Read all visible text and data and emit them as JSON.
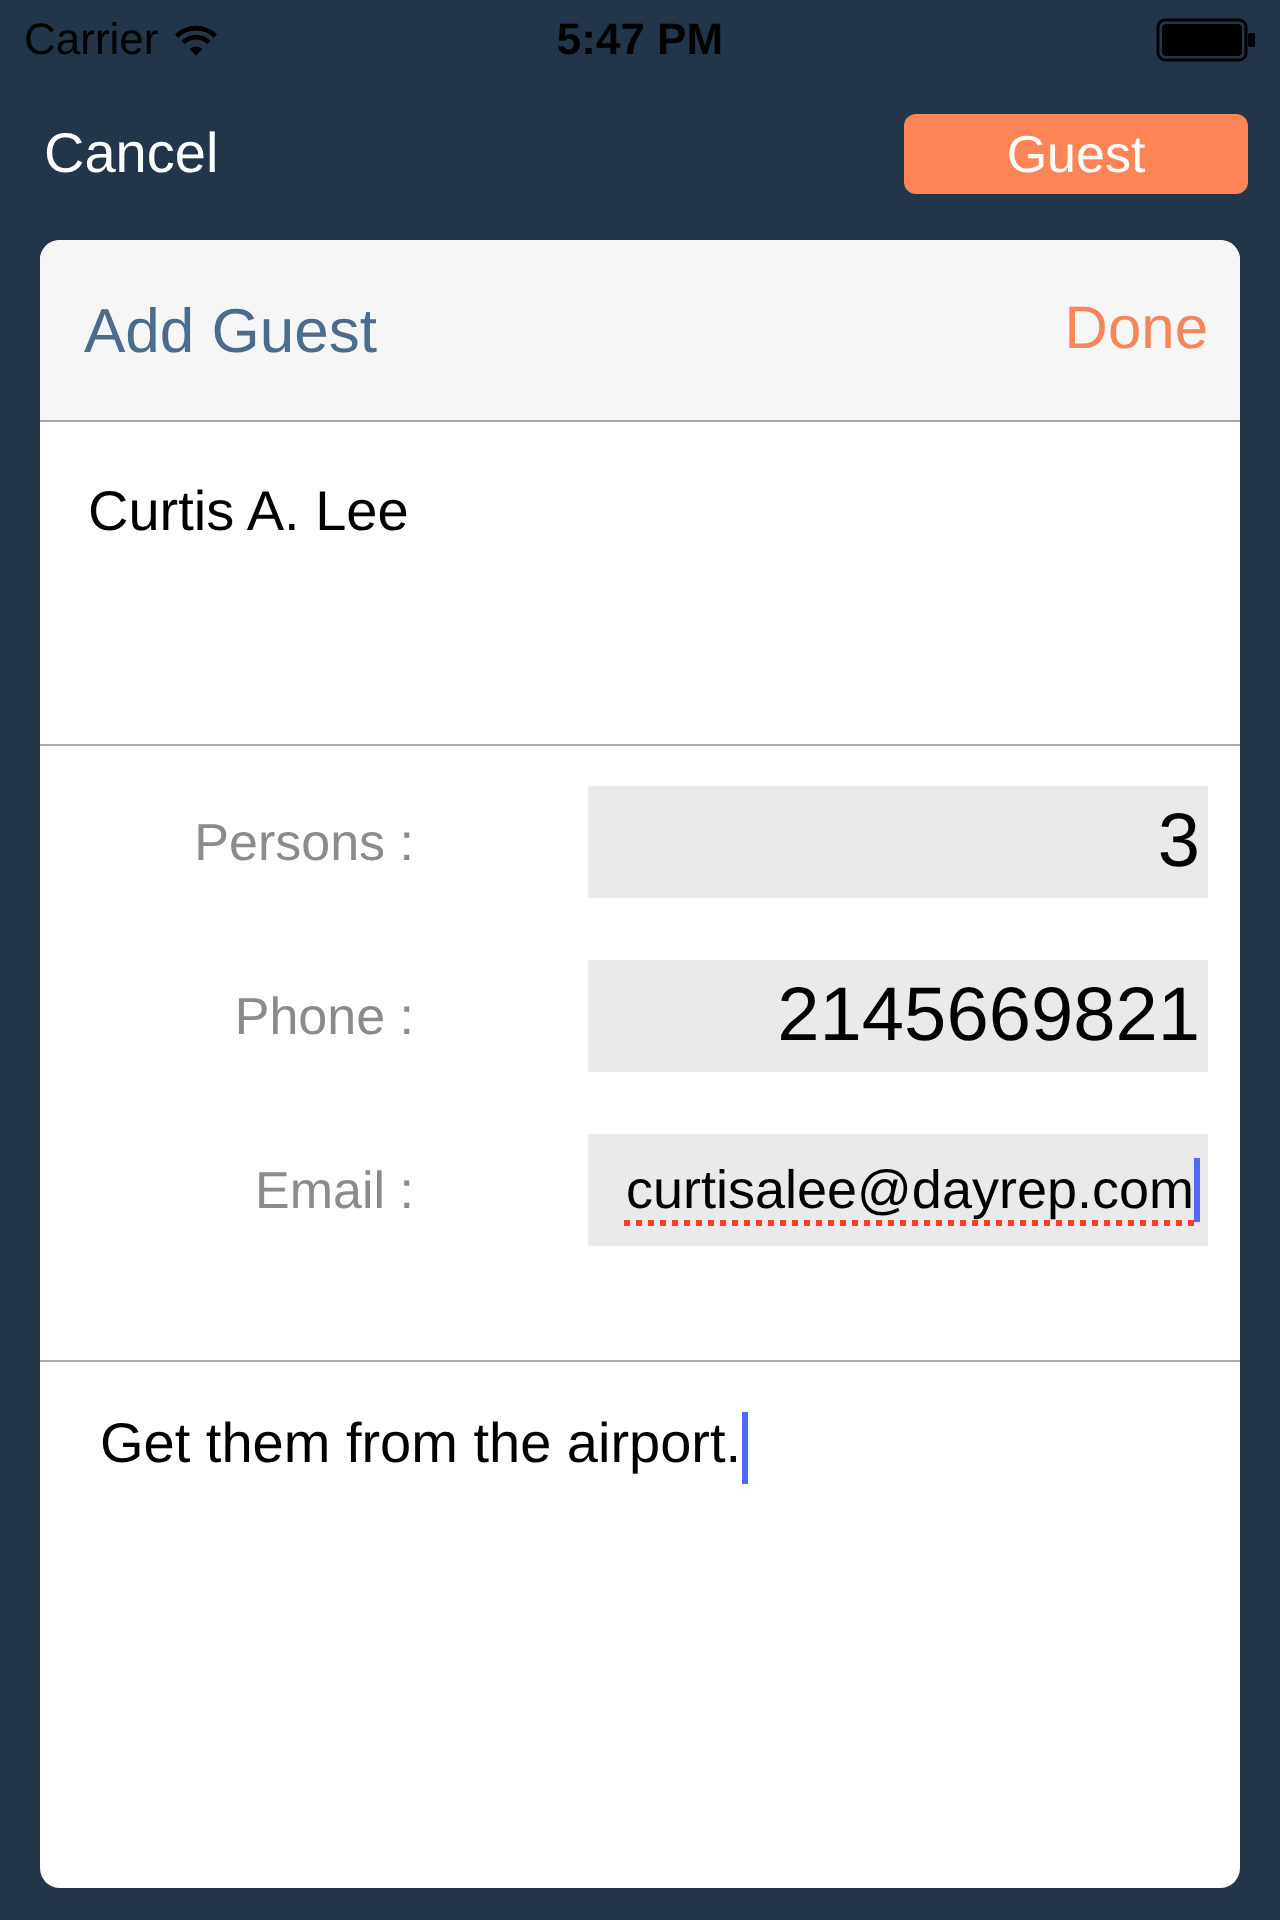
{
  "status_bar": {
    "carrier": "Carrier",
    "time": "5:47 PM"
  },
  "nav_bar": {
    "left_button": "Cancel",
    "right_button": "Guest"
  },
  "sheet": {
    "title": "Add Guest",
    "action": "Done",
    "name": {
      "value": "Curtis A. Lee",
      "focused": false
    },
    "fields": [
      {
        "kind": "number",
        "label": "Persons :",
        "value": "3",
        "focused": false,
        "misspelled": false
      },
      {
        "kind": "number",
        "label": "Phone :",
        "value": "2145669821",
        "focused": false,
        "misspelled": false
      },
      {
        "kind": "email",
        "label": "Email :",
        "value": "curtisalee@dayrep.com",
        "focused": true,
        "misspelled": true
      }
    ],
    "notes": {
      "value": "Get them from the airport.",
      "focused": true
    }
  }
}
